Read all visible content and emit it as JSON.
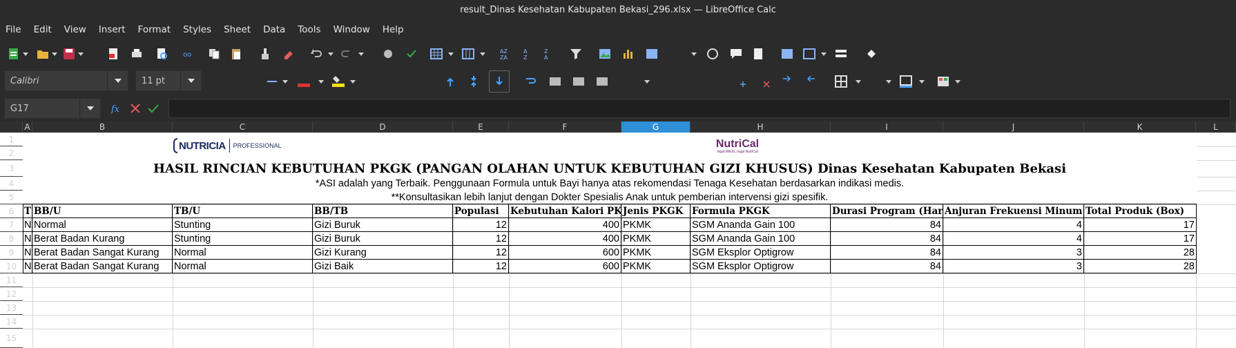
{
  "window": {
    "title": "result_Dinas Kesehatan Kabupaten Bekasi_296.xlsx — LibreOffice Calc"
  },
  "menu": [
    "File",
    "Edit",
    "View",
    "Insert",
    "Format",
    "Styles",
    "Sheet",
    "Data",
    "Tools",
    "Window",
    "Help"
  ],
  "format_bar": {
    "font_name": "Calibri",
    "font_size": "11 pt"
  },
  "formula_bar": {
    "cell_ref": "G17",
    "content": ""
  },
  "columns": [
    "A",
    "B",
    "C",
    "D",
    "E",
    "F",
    "G",
    "H",
    "I",
    "J",
    "K",
    "L"
  ],
  "selected_column": "G",
  "rows": [
    "1",
    "2",
    "3",
    "4",
    "5",
    "6",
    "7",
    "8",
    "9",
    "10",
    "11",
    "12",
    "13",
    "14",
    "15"
  ],
  "logos": {
    "left": "NUTRICIA",
    "left_sub": "PROFESSIONAL",
    "right": "NutriCal",
    "right_sub": "Ingat MAJU, Ingat NutriCal"
  },
  "sheet": {
    "title": "HASIL RINCIAN KEBUTUHAN PKGK (PANGAN OLAHAN UNTUK KEBUTUHAN GIZI KHUSUS) Dinas Kesehatan Kabupaten Bekasi",
    "note1": "*ASI adalah yang Terbaik. Penggunaan Formula untuk Bayi hanya atas rekomendasi Tenaga Kesehatan berdasarkan indikasi medis.",
    "note2": "**Konsultasikan lebih lanjut dengan Dokter Spesialis Anak untuk pemberian intervensi gizi spesifik.",
    "headers": [
      "T",
      "BB/U",
      "TB/U",
      "BB/TB",
      "Populasi",
      "Kebutuhan Kalori PK",
      "Jenis PKGK",
      "Formula PKGK",
      "Durasi Program (Har",
      "Anjuran Frekuensi Minum",
      "Total Produk (Box)"
    ],
    "data": [
      [
        "N",
        "Normal",
        "Stunting",
        "Gizi Buruk",
        "12",
        "400",
        "PKMK",
        "SGM Ananda Gain 100",
        "84",
        "4",
        "17"
      ],
      [
        "N",
        "Berat Badan Kurang",
        "Stunting",
        "Gizi Buruk",
        "12",
        "400",
        "PKMK",
        "SGM Ananda Gain 100",
        "84",
        "4",
        "17"
      ],
      [
        "N",
        "Berat Badan Sangat Kurang",
        "Normal",
        "Gizi Kurang",
        "12",
        "600",
        "PKMK",
        "SGM Eksplor Optigrow",
        "84",
        "3",
        "28"
      ],
      [
        "N",
        "Berat Badan Sangat Kurang",
        "Normal",
        "Gizi Baik",
        "12",
        "600",
        "PKMK",
        "SGM Eksplor Optigrow",
        "84",
        "3",
        "28"
      ]
    ]
  },
  "colors": {
    "selected_header": "#2f8fd8",
    "toolbar_bg": "#2b2b2b",
    "nutricia_blue": "#1a2a5c",
    "nutrical_purple": "#6b2a6b",
    "nutrical_red": "#d23a3a"
  }
}
